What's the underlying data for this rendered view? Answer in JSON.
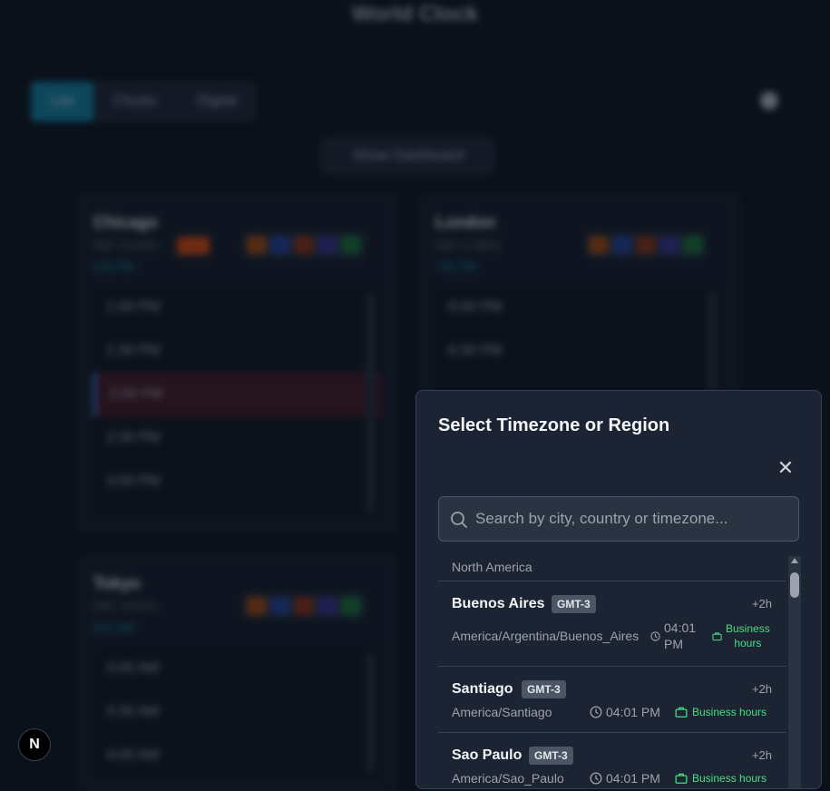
{
  "app": {
    "title": "World Clock"
  },
  "view_tabs": [
    {
      "label": "List",
      "active": true
    },
    {
      "label": "Clocks",
      "active": false
    },
    {
      "label": "Digital",
      "active": false
    }
  ],
  "dashboard_button": "Show Dashboard",
  "cards": [
    {
      "city": "Chicago",
      "sub": "GMT -5 (CDT)",
      "time": "2:01 PM",
      "slots": [
        "1:00 PM",
        "1:30 PM",
        "2:00 PM",
        "2:30 PM",
        "3:00 PM"
      ]
    },
    {
      "city": "London",
      "sub": "GMT +1 (BST)",
      "time": "7:01 PM",
      "slots": [
        "6:00 PM",
        "6:30 PM"
      ]
    },
    {
      "city": "Tokyo",
      "sub": "GMT +9 (JST)",
      "time": "4:01 AM",
      "slots": [
        "3:00 AM",
        "3:30 AM",
        "4:00 AM"
      ]
    }
  ],
  "modal": {
    "title": "Select Timezone or Region",
    "close_icon": "close-icon",
    "search_placeholder": "Search by city, country or timezone...",
    "group": "North America",
    "items": [
      {
        "city": "Buenos Aires",
        "gmt": "GMT-3",
        "offset": "+2h",
        "zone": "America/Argentina/Buenos_Aires",
        "time_line1": "04:01",
        "time_line2": "PM",
        "biz_line1": "Business",
        "biz_line2": "hours"
      },
      {
        "city": "Santiago",
        "gmt": "GMT-3",
        "offset": "+2h",
        "zone": "America/Santiago",
        "time": "04:01 PM",
        "biz": "Business hours"
      },
      {
        "city": "Sao Paulo",
        "gmt": "GMT-3",
        "offset": "+2h",
        "zone": "America/Sao_Paulo",
        "time": "04:01 PM",
        "biz": "Business hours"
      }
    ]
  },
  "next_badge": "N",
  "colors": {
    "accent": "#0e7490",
    "business": "#4ade80",
    "modal_bg": "#1c2433"
  }
}
